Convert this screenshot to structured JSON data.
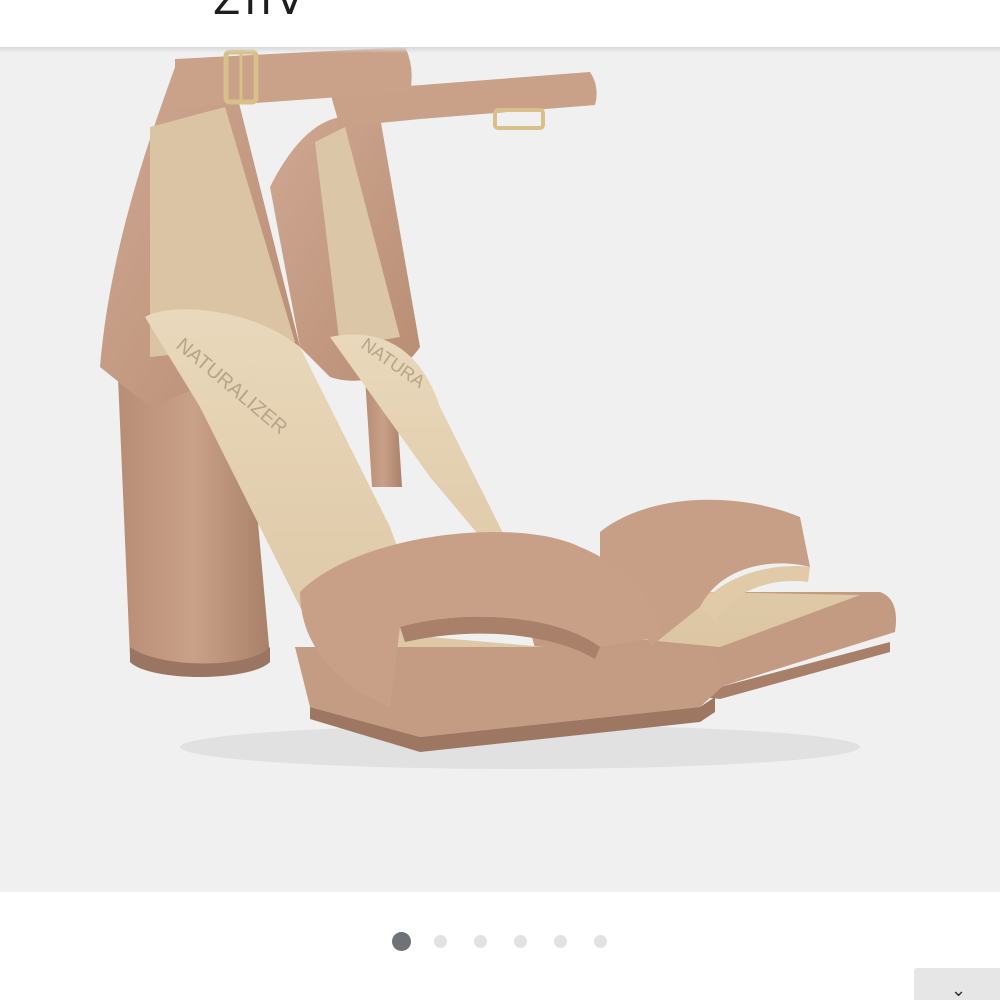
{
  "header": {
    "brand_partial": "ZIIV"
  },
  "product_image": {
    "alt": "Suede block-heel ankle-strap sandals",
    "insole_logo_text": "NATURALIZER",
    "colors": {
      "background": "#f0f0f0",
      "suede": "#c9a088",
      "suede_shadow": "#a97f68",
      "insole": "#e6d3b4",
      "buckle": "#d8c08a"
    }
  },
  "pager": {
    "count": 6,
    "active_index": 0
  },
  "corner_button": {
    "icon": "chevron-down-icon",
    "glyph": "⌄"
  }
}
